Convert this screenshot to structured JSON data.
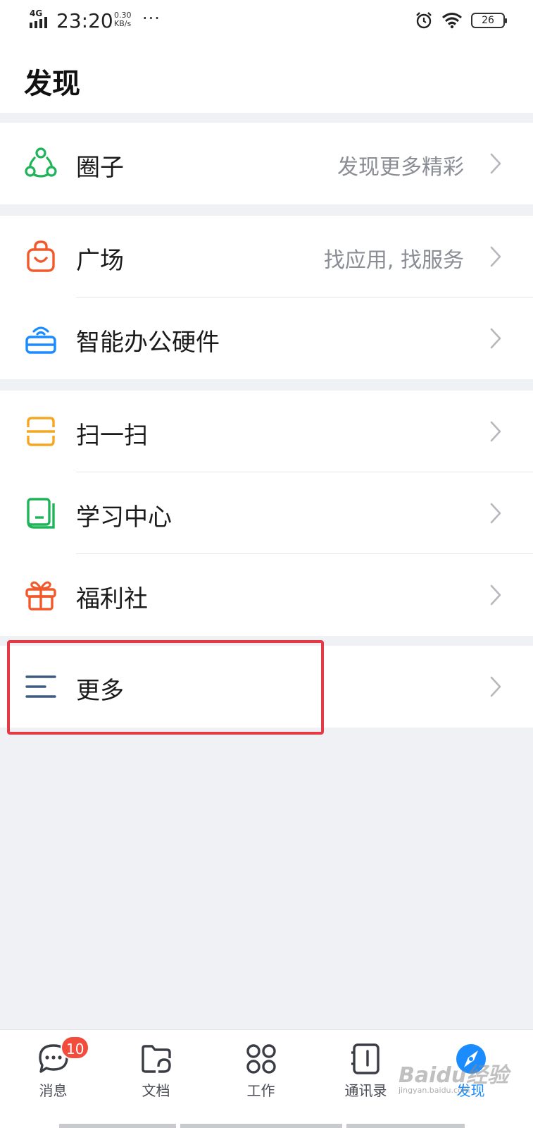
{
  "status_bar": {
    "network": "4G",
    "time": "23:20",
    "speed_value": "0.30",
    "speed_unit": "KB/s",
    "more": "···",
    "battery": "26"
  },
  "header": {
    "title": "发现"
  },
  "groups": [
    {
      "items": [
        {
          "label": "圈子",
          "hint": "发现更多精彩",
          "icon": "circle-community-icon",
          "color": "#1fb35a"
        }
      ]
    },
    {
      "items": [
        {
          "label": "广场",
          "hint": "找应用, 找服务",
          "icon": "shopping-bag-icon",
          "color": "#f2592a"
        },
        {
          "label": "智能办公硬件",
          "hint": "",
          "icon": "smart-hardware-icon",
          "color": "#1a8cff"
        }
      ]
    },
    {
      "items": [
        {
          "label": "扫一扫",
          "hint": "",
          "icon": "scan-icon",
          "color": "#f5a623"
        },
        {
          "label": "学习中心",
          "hint": "",
          "icon": "book-icon",
          "color": "#1fb35a"
        },
        {
          "label": "福利社",
          "hint": "",
          "icon": "gift-icon",
          "color": "#f2592a"
        }
      ]
    },
    {
      "items": [
        {
          "label": "更多",
          "hint": "",
          "icon": "menu-lines-icon",
          "color": "#3d5a80"
        }
      ]
    }
  ],
  "tabs": [
    {
      "label": "消息",
      "icon": "message-icon",
      "badge": "10"
    },
    {
      "label": "文档",
      "icon": "document-folder-icon"
    },
    {
      "label": "工作",
      "icon": "work-grid-icon"
    },
    {
      "label": "通讯录",
      "icon": "contacts-icon"
    },
    {
      "label": "发现",
      "icon": "discover-compass-icon",
      "active": true
    }
  ],
  "watermark": {
    "text": "Baidu经验",
    "sub": "jingyan.baidu.com"
  },
  "colors": {
    "accent": "#1a8cff",
    "highlight": "#e53a45",
    "badge": "#f24c3d"
  }
}
